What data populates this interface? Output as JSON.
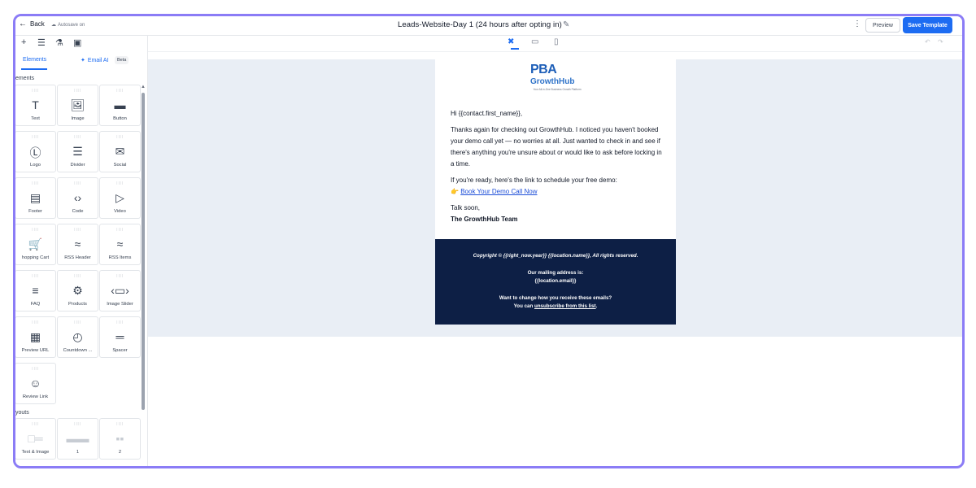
{
  "header": {
    "back_label": "Back",
    "autosave_label": "Autosave on",
    "title": "Leads-Website-Day 1 (24 hours after opting in)",
    "preview_label": "Preview",
    "save_label": "Save Template"
  },
  "sidebar": {
    "tab_elements": "Elements",
    "tab_email_ai": "Email AI",
    "beta_badge": "Beta",
    "section_elements": "ements",
    "section_layouts": "youts",
    "elements": [
      {
        "label": "Text",
        "icon": "text-icon"
      },
      {
        "label": "Image",
        "icon": "image-icon"
      },
      {
        "label": "Button",
        "icon": "button-icon"
      },
      {
        "label": "Logo",
        "icon": "logo-icon"
      },
      {
        "label": "Divider",
        "icon": "divider-icon"
      },
      {
        "label": "Social",
        "icon": "social-icon"
      },
      {
        "label": "Footer",
        "icon": "footer-icon"
      },
      {
        "label": "Code",
        "icon": "code-icon"
      },
      {
        "label": "Video",
        "icon": "video-icon"
      },
      {
        "label": "hopping Cart",
        "icon": "shopping-cart-icon"
      },
      {
        "label": "RSS Header",
        "icon": "rss-icon"
      },
      {
        "label": "RSS Items",
        "icon": "rss-icon"
      },
      {
        "label": "FAQ",
        "icon": "faq-icon"
      },
      {
        "label": "Products",
        "icon": "products-icon"
      },
      {
        "label": "Image Slider",
        "icon": "image-slider-icon"
      },
      {
        "label": "Preview URL",
        "icon": "preview-url-icon"
      },
      {
        "label": "Countdown ...",
        "icon": "countdown-icon"
      },
      {
        "label": "Spacer",
        "icon": "spacer-icon"
      },
      {
        "label": "Review Link",
        "icon": "review-link-icon"
      }
    ],
    "layouts": [
      {
        "label": "Text & Image"
      },
      {
        "label": "1"
      },
      {
        "label": "2"
      }
    ]
  },
  "email": {
    "logo_text": "PBA",
    "logo_subtext": "GrowthHub",
    "logo_tagline": "Your All-in-One Business Growth Platform",
    "greeting": "Hi {{contact.first_name}},",
    "paragraph1": "Thanks again for checking out GrowthHub. I noticed you haven't booked your demo call yet — no worries at all. Just wanted to check in and see if there's anything you're unsure about or would like to ask before locking in a time.",
    "paragraph2": "If you're ready, here's the link to schedule your free demo:",
    "link_emoji": "👉",
    "link_text": "Book Your Demo Call Now",
    "signoff": "Talk soon,",
    "signature": "The GrowthHub Team",
    "footer_copyright": "Copyright © {{right_now.year}}  {{location.name}}, All rights reserved.",
    "footer_mailing_label": "Our mailing address is:",
    "footer_mailing_value": "{{location.email}}",
    "footer_change_label": "Want to change how you receive these emails?",
    "footer_you_can": "You can ",
    "footer_unsubscribe": "unsubscribe from this list",
    "footer_period": "."
  },
  "colors": {
    "accent": "#1d6cf2",
    "frame": "#8b7cf6",
    "canvas_bg": "#e9eef5",
    "footer_bg": "#0d1f45"
  }
}
